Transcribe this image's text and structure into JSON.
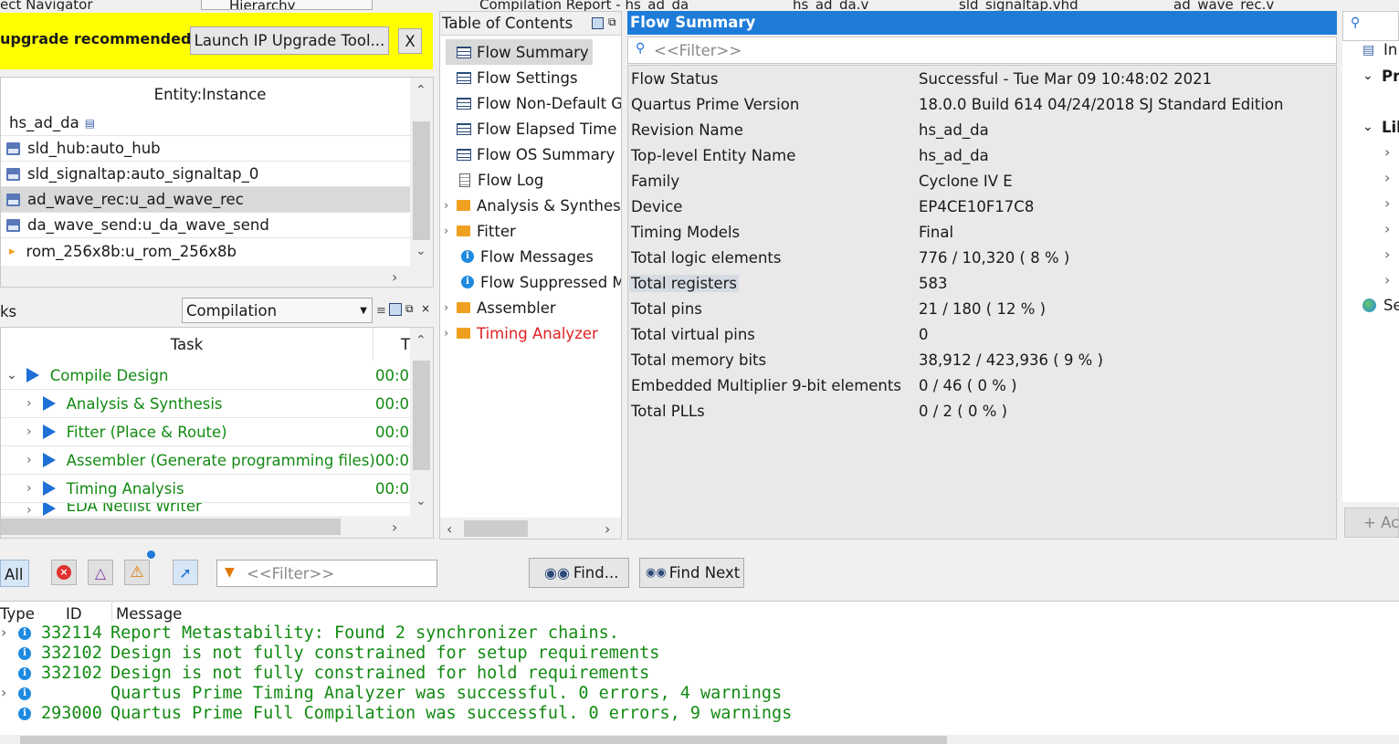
{
  "top_tabs": {
    "navigator_title": "ect Navigator",
    "hierarchy_select": "Hierarchy",
    "compilation_report_tab": "Compilation Report - hs_ad_da",
    "tab_hs_ad_da_v": "hs_ad_da.v",
    "tab_sld_signaltap": "sld_signaltap.vhd",
    "tab_ad_wave_rec": "ad_wave_rec.v"
  },
  "banner": {
    "text": "upgrade recommended.",
    "launch_button": "Launch IP Upgrade Tool...",
    "close_button": "X",
    "color": "#ffff00"
  },
  "hierarchy": {
    "header": "Entity:Instance",
    "root": "hs_ad_da",
    "items": [
      {
        "label": "sld_hub:auto_hub",
        "icon": "vhdl-file-icon"
      },
      {
        "label": "sld_signaltap:auto_signaltap_0",
        "icon": "vhdl-file-icon"
      },
      {
        "label": "ad_wave_rec:u_ad_wave_rec",
        "icon": "vhdl-file-icon"
      },
      {
        "label": "da_wave_send:u_da_wave_send",
        "icon": "vhdl-file-icon"
      },
      {
        "label": "rom_256x8b:u_rom_256x8b",
        "icon": "ip-icon"
      }
    ]
  },
  "tasks": {
    "title": "ks",
    "flow_select": "Compilation",
    "col_task": "Task",
    "col_time": "T",
    "rows": [
      {
        "label": "Compile Design",
        "time": "00:0"
      },
      {
        "label": "Analysis & Synthesis",
        "time": "00:0"
      },
      {
        "label": "Fitter (Place & Route)",
        "time": "00:0"
      },
      {
        "label": "Assembler (Generate programming files)",
        "time": "00:0"
      },
      {
        "label": "Timing Analysis",
        "time": "00:0"
      },
      {
        "label": "EDA Netlist Writer",
        "time": ""
      }
    ]
  },
  "toc": {
    "title": "Table of Contents",
    "items": [
      {
        "label": "Flow Summary",
        "icon": "table-icon"
      },
      {
        "label": "Flow Settings",
        "icon": "table-icon"
      },
      {
        "label": "Flow Non-Default Global Settings",
        "icon": "table-icon"
      },
      {
        "label": "Flow Elapsed Time",
        "icon": "table-icon"
      },
      {
        "label": "Flow OS Summary",
        "icon": "table-icon"
      },
      {
        "label": "Flow Log",
        "icon": "document-icon"
      },
      {
        "label": "Analysis & Synthesis",
        "icon": "folder-icon"
      },
      {
        "label": "Fitter",
        "icon": "folder-icon"
      },
      {
        "label": "Flow Messages",
        "icon": "info-icon"
      },
      {
        "label": "Flow Suppressed Messages",
        "icon": "info-icon"
      },
      {
        "label": "Assembler",
        "icon": "folder-icon"
      },
      {
        "label": "Timing Analyzer",
        "icon": "folder-icon"
      }
    ]
  },
  "flow_summary": {
    "title": "Flow Summary",
    "filter_placeholder": "<<Filter>>",
    "rows": [
      {
        "key": "Flow Status",
        "value": "Successful - Tue Mar 09 10:48:02 2021"
      },
      {
        "key": "Quartus Prime Version",
        "value": "18.0.0 Build 614 04/24/2018 SJ Standard Edition"
      },
      {
        "key": "Revision Name",
        "value": "hs_ad_da"
      },
      {
        "key": "Top-level Entity Name",
        "value": "hs_ad_da"
      },
      {
        "key": "Family",
        "value": "Cyclone IV E"
      },
      {
        "key": "Device",
        "value": "EP4CE10F17C8"
      },
      {
        "key": "Timing Models",
        "value": "Final"
      },
      {
        "key": "Total logic elements",
        "value": "776 / 10,320 ( 8 % )"
      },
      {
        "key": "Total registers",
        "value": "583"
      },
      {
        "key": "Total pins",
        "value": "21 / 180 ( 12 % )"
      },
      {
        "key": "Total virtual pins",
        "value": "0"
      },
      {
        "key": "Total memory bits",
        "value": "38,912 / 423,936 ( 9 % )"
      },
      {
        "key": "Embedded Multiplier 9-bit elements",
        "value": "0 / 46 ( 0 % )"
      },
      {
        "key": "Total PLLs",
        "value": "0 / 2 ( 0 % )"
      }
    ]
  },
  "right_panel": {
    "item1": "In",
    "item2": "Pr",
    "item3": "Lil",
    "item4": "Se",
    "add_button": "+ Ac"
  },
  "messages": {
    "all_button": "All",
    "filter_placeholder": "<<Filter>>",
    "find_button": "Find...",
    "find_next_button": "Find Next",
    "col_type": "Type",
    "col_id": "ID",
    "col_message": "Message",
    "rows": [
      {
        "id": "332114",
        "text": "Report Metastability: Found 2 synchronizer chains.",
        "expandable": true
      },
      {
        "id": "332102",
        "text": "Design is not fully constrained for setup requirements",
        "expandable": false
      },
      {
        "id": "332102",
        "text": "Design is not fully constrained for hold requirements",
        "expandable": false
      },
      {
        "id": "",
        "text": "Quartus Prime Timing Analyzer was successful. 0 errors, 4 warnings",
        "expandable": true
      },
      {
        "id": "293000",
        "text": "Quartus Prime Full Compilation was successful. 0 errors, 9 warnings",
        "expandable": false
      }
    ]
  },
  "colors": {
    "accent_blue": "#1e7cd8",
    "success_green": "#128a12",
    "timing_red": "#e02020"
  }
}
